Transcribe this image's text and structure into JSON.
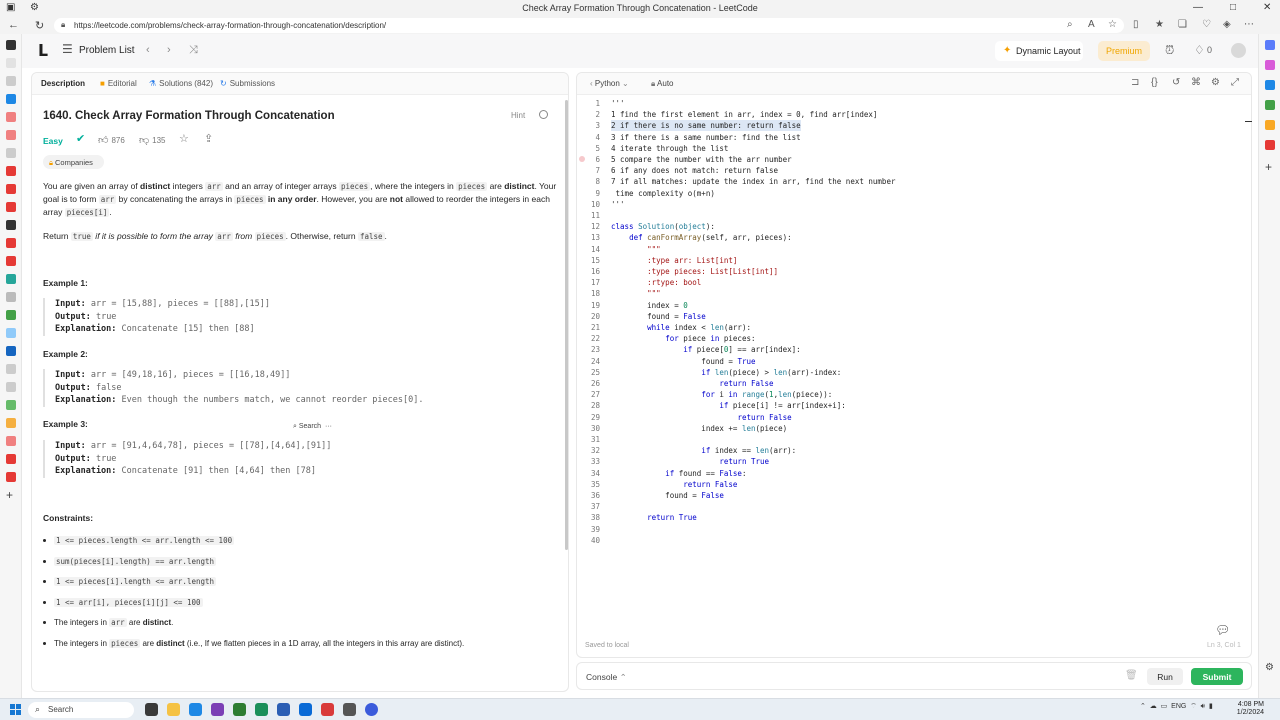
{
  "browser": {
    "window_title": "Check Array Formation Through Concatenation - LeetCode",
    "url": "https://leetcode.com/problems/check-array-formation-through-concatenation/description/"
  },
  "header": {
    "problem_list": "Problem List",
    "dynamic_layout": "Dynamic Layout",
    "premium": "Premium",
    "streak_count": "0"
  },
  "left_tabs": [
    {
      "label": "Description"
    },
    {
      "label": "Editorial"
    },
    {
      "label": "Solutions (842)"
    },
    {
      "label": "Submissions"
    }
  ],
  "problem": {
    "title": "1640. Check Array Formation Through Concatenation",
    "hint": "Hint",
    "difficulty": "Easy",
    "likes": "876",
    "dislikes": "135",
    "companies": "Companies",
    "desc_p1_a": "You are given an array of ",
    "desc_p1_b": "distinct",
    "desc_p1_c": " integers ",
    "desc_p1_arr": "arr",
    "desc_p1_d": " and an array of integer arrays ",
    "desc_p1_pieces": "pieces",
    "desc_p1_e": ", where the integers in ",
    "desc_p1_pieces2": "pieces",
    "desc_p1_f": " are ",
    "desc_p1_g": "distinct",
    "desc_p1_h": ". Your goal is to form ",
    "desc_p1_arr2": "arr",
    "desc_p1_i": " by concatenating the arrays in ",
    "desc_p1_pieces3": "pieces",
    "desc_p1_j": " in any order",
    "desc_p1_k": ". However, you are ",
    "desc_p1_l": "not",
    "desc_p1_m": " allowed to reorder the integers in each array ",
    "desc_p1_pi": "pieces[i]",
    "desc_p1_n": ".",
    "desc_p2_a": "Return ",
    "desc_p2_true": "true",
    "desc_p2_b": " if it is possible to form the array ",
    "desc_p2_arr": "arr",
    "desc_p2_c": " from ",
    "desc_p2_pieces": "pieces",
    "desc_p2_d": ". Otherwise, return ",
    "desc_p2_false": "false",
    "desc_p2_e": "."
  },
  "examples": [
    {
      "heading": "Example 1:",
      "input": "arr = [15,88], pieces = [[88],[15]]",
      "output": "true",
      "explanation": "Concatenate [15] then [88]"
    },
    {
      "heading": "Example 2:",
      "input": "arr = [49,18,16], pieces = [[16,18,49]]",
      "output": "false",
      "explanation": "Even though the numbers match, we cannot reorder pieces[0]."
    },
    {
      "heading": "Example 3:",
      "input": "arr = [91,4,64,78], pieces = [[78],[4,64],[91]]",
      "output": "true",
      "explanation": "Concatenate [91] then [4,64] then [78]"
    }
  ],
  "labels": {
    "input": "Input:",
    "output": "Output:",
    "explanation": "Explanation:"
  },
  "search_popup": {
    "label": "Search",
    "more": "···"
  },
  "constraints": {
    "heading": "Constraints:",
    "items": [
      {
        "code": "1 <= pieces.length <= arr.length <= 100"
      },
      {
        "code": "sum(pieces[i].length) == arr.length"
      },
      {
        "code": "1 <= pieces[i].length <= arr.length"
      },
      {
        "code": "1 <= arr[i], pieces[i][j] <= 100"
      }
    ],
    "item5_a": "The integers in ",
    "item5_code": "arr",
    "item5_b": " are ",
    "item5_c": "distinct",
    "item5_d": ".",
    "item6_a": "The integers in ",
    "item6_code": "pieces",
    "item6_b": " are ",
    "item6_c": "distinct",
    "item6_d": " (i.e., If we flatten pieces in a 1D array, all the integers in this array are distinct)."
  },
  "editor": {
    "language": "Python",
    "mode": "Auto",
    "saved": "Saved to local",
    "cursor": "Ln 3, Col 1",
    "lines": [
      "'''",
      "1 find the first element in arr, index = 0, find arr[index]",
      "2 if there is no same number: return false",
      "3 if there is a same number: find the list",
      "4 iterate through the list",
      "5 compare the number with the arr number",
      "6 if any does not match: return false",
      "7 if all matches: update the index in arr, find the next number",
      " time complexity o(m+n)",
      "'''",
      "",
      "class Solution(object):",
      "    def canFormArray(self, arr, pieces):",
      "        \"\"\"",
      "        :type arr: List[int]",
      "        :type pieces: List[List[int]]",
      "        :rtype: bool",
      "        \"\"\"",
      "        index = 0",
      "        found = False",
      "        while index < len(arr):",
      "            for piece in pieces:",
      "                if piece[0] == arr[index]:",
      "                    found = True",
      "                    if len(piece) > len(arr)-index:",
      "                        return False",
      "                    for i in range(1,len(piece)):",
      "                        if piece[i] != arr[index+i]:",
      "                            return False",
      "                    index += len(piece)",
      "",
      "                    if index == len(arr):",
      "                        return True",
      "            if found == False:",
      "                return False",
      "            found = False",
      "",
      "        return True",
      "",
      ""
    ]
  },
  "bottom": {
    "console": "Console",
    "run": "Run",
    "submit": "Submit"
  },
  "taskbar": {
    "search": "Search",
    "lang": "ENG",
    "time": "4:08 PM",
    "date": "1/2/2024"
  }
}
